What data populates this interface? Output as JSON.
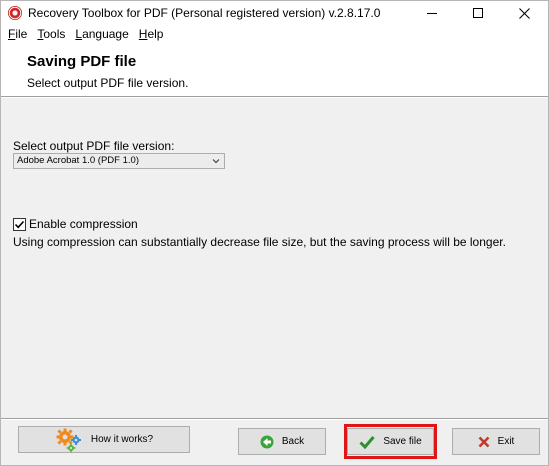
{
  "window": {
    "title": "Recovery Toolbox for PDF (Personal registered version) v.2.8.17.0"
  },
  "menu": {
    "items": [
      {
        "label": "File",
        "mnemonic": "F",
        "rest": "ile"
      },
      {
        "label": "Tools",
        "mnemonic": "T",
        "rest": "ools"
      },
      {
        "label": "Language",
        "mnemonic": "L",
        "rest": "anguage"
      },
      {
        "label": "Help",
        "mnemonic": "H",
        "rest": "elp"
      }
    ]
  },
  "header": {
    "title": "Saving PDF file",
    "subtitle": "Select output PDF file version."
  },
  "main": {
    "version_label": "Select output PDF file version:",
    "version_selected": "Adobe Acrobat 1.0 (PDF 1.0)",
    "compression_label": "Enable compression",
    "compression_checked": true,
    "compression_note": "Using compression can substantially decrease file size, but the saving process will be longer."
  },
  "footer": {
    "how_label": "How it works?",
    "back_label": "Back",
    "save_label": "Save file",
    "exit_label": "Exit"
  },
  "colors": {
    "highlight": "#e01515",
    "back_icon": "#3aa43a",
    "save_icon": "#2f8f2f",
    "exit_icon": "#c0392b",
    "gear_orange": "#f08a1c",
    "gear_blue": "#3d8fd6",
    "gear_green": "#57b83a"
  },
  "icons": {
    "app": "recovery-toolbox-icon",
    "how": "gears-icon",
    "back": "back-arrow-icon",
    "save": "checkmark-icon",
    "exit": "x-icon"
  }
}
